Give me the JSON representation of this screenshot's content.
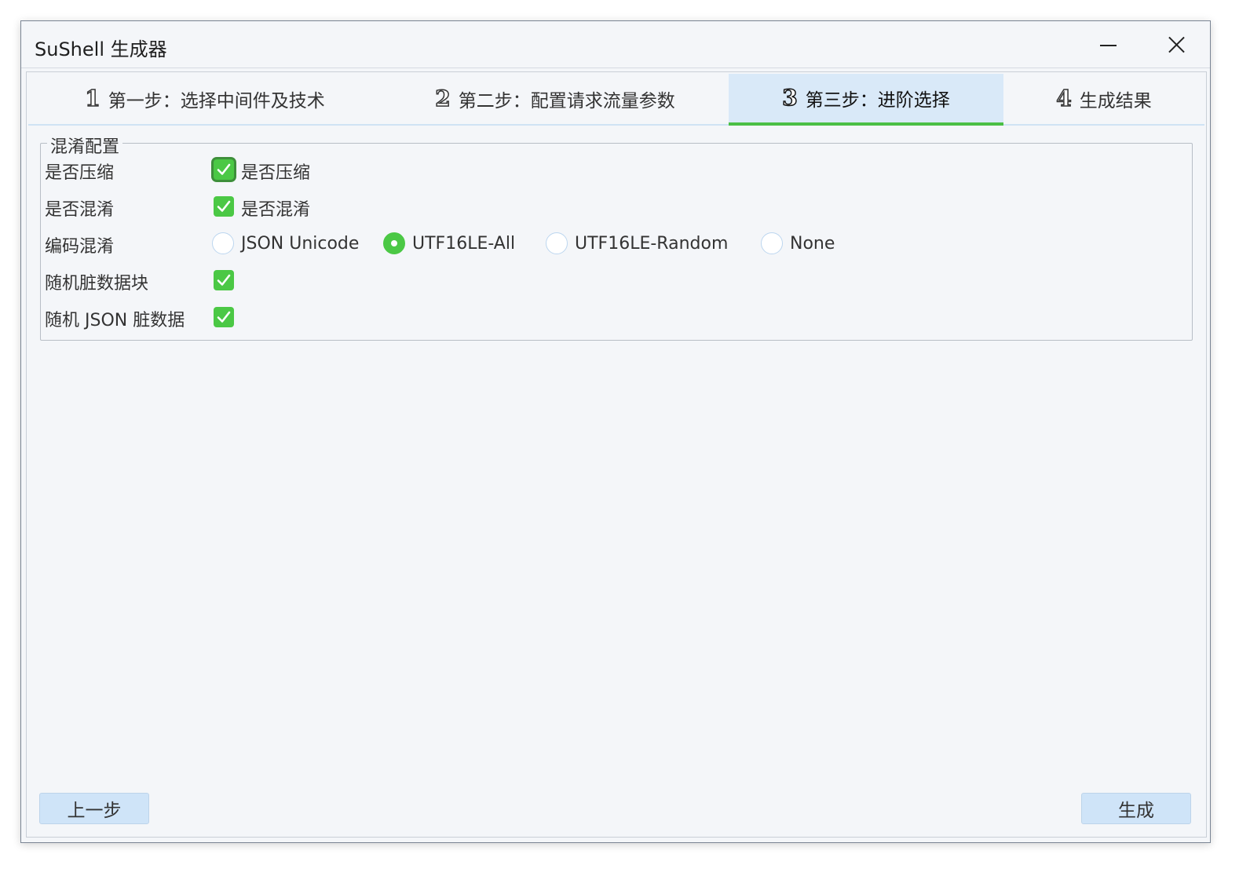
{
  "window": {
    "title": "SuShell 生成器"
  },
  "tabs": [
    {
      "num": "1",
      "label": "第一步：选择中间件及技术",
      "active": false
    },
    {
      "num": "2",
      "label": "第二步：配置请求流量参数",
      "active": false
    },
    {
      "num": "3",
      "label": "第三步：进阶选择",
      "active": true
    },
    {
      "num": "4",
      "label": "生成结果",
      "active": false
    }
  ],
  "group": {
    "legend": "混淆配置",
    "compress": {
      "label": "是否压缩",
      "checkbox_text": "是否压缩",
      "checked": true
    },
    "obfuscate": {
      "label": "是否混淆",
      "checkbox_text": "是否混淆",
      "checked": true
    },
    "encoding": {
      "label": "编码混淆",
      "options": [
        "JSON Unicode",
        "UTF16LE-All",
        "UTF16LE-Random",
        "None"
      ],
      "selected": "UTF16LE-All"
    },
    "dirty_block": {
      "label": "随机脏数据块",
      "checked": true
    },
    "dirty_json": {
      "label": "随机 JSON 脏数据",
      "checked": true
    }
  },
  "buttons": {
    "prev": "上一步",
    "generate": "生成"
  },
  "colors": {
    "accent_green": "#4bc845",
    "tab_active_bg": "#d9e9f8",
    "button_bg": "#cfe4f8"
  }
}
